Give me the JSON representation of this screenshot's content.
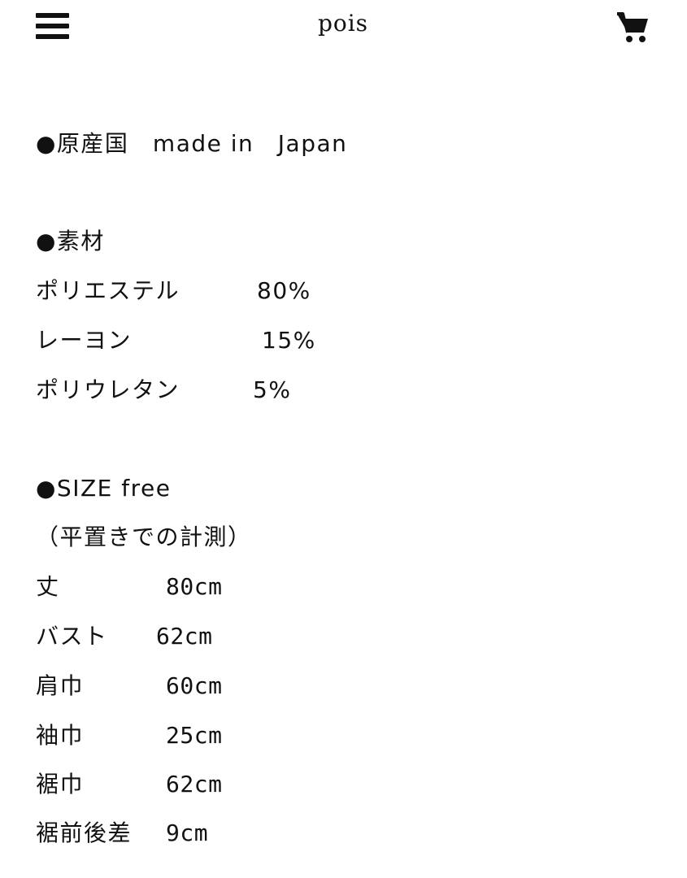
{
  "header": {
    "brand": "pois",
    "menu_icon": "hamburger-menu-icon",
    "cart_icon": "shopping-cart-icon"
  },
  "origin": {
    "text": "●原産国　made in　Japan"
  },
  "material": {
    "heading": "●素材",
    "items": [
      {
        "name": "ポリエステル",
        "value": "80%"
      },
      {
        "name": "レーヨン",
        "value": "15%"
      },
      {
        "name": "ポリウレタン",
        "value": "5%"
      }
    ]
  },
  "size": {
    "heading": "●SIZE free",
    "note": "（平置きでの計測）",
    "items": [
      {
        "name": "丈",
        "value": "80cm"
      },
      {
        "name": "バスト",
        "value": "62cm"
      },
      {
        "name": "肩巾",
        "value": "60cm"
      },
      {
        "name": "袖巾",
        "value": "25cm"
      },
      {
        "name": "裾巾",
        "value": "62cm"
      },
      {
        "name": "裾前後差",
        "value": "9cm"
      }
    ]
  }
}
